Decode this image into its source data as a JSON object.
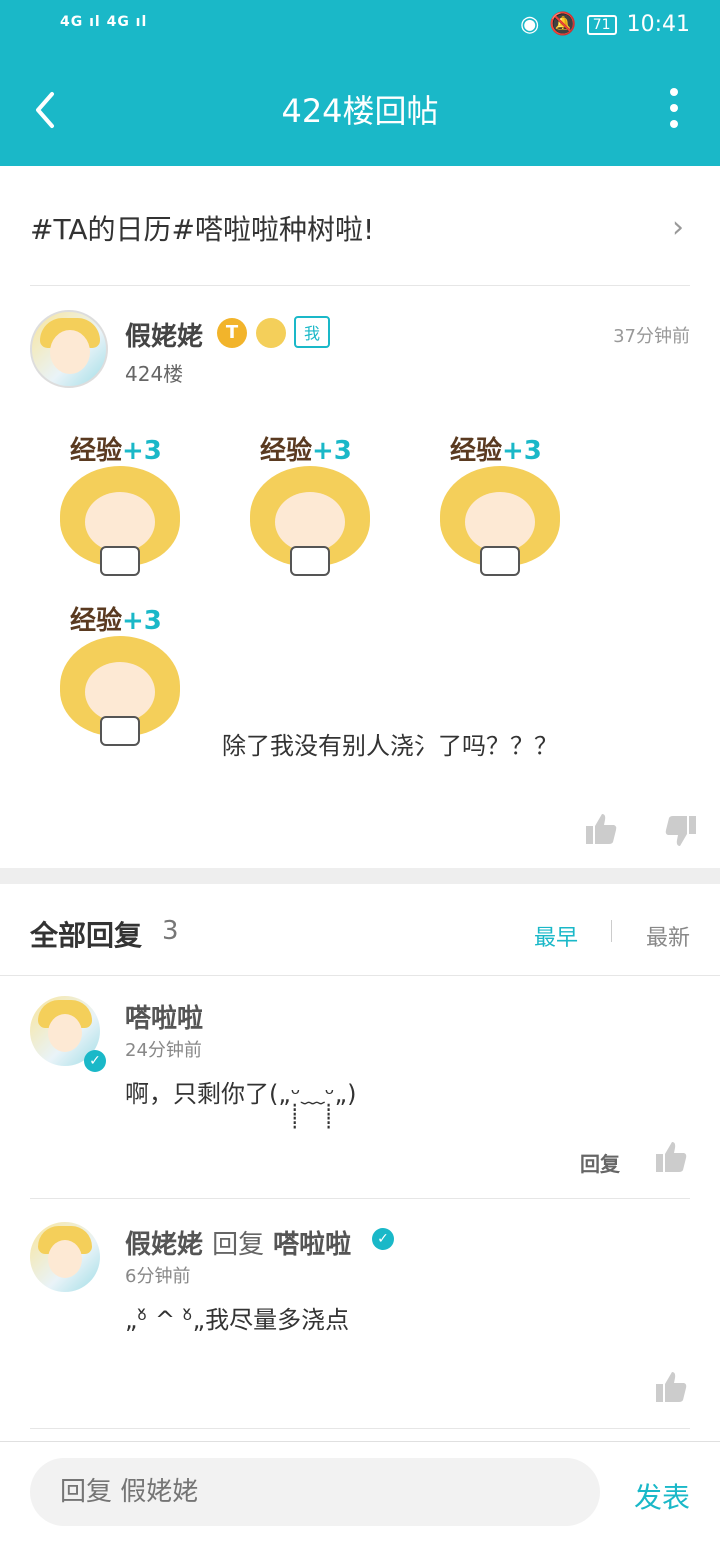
{
  "status_bar": {
    "network": "4G ıl 4G ıl",
    "battery": "71",
    "time": "10:41"
  },
  "header": {
    "title": "424楼回帖"
  },
  "topic": {
    "text": "#TA的日历#嗒啦啦种树啦!"
  },
  "post": {
    "author": "假姥姥",
    "badge_t": "T",
    "me_badge": "我",
    "floor": "424楼",
    "time": "37分钟前",
    "sticker_label_prefix": "经验",
    "sticker_label_bonus": "+3",
    "text": "除了我没有别人浇氵了吗？？？"
  },
  "replies": {
    "title": "全部回复",
    "count": "3",
    "sort_earliest": "最早",
    "sort_latest": "最新",
    "items": [
      {
        "name": "嗒啦啦",
        "time": "24分钟前",
        "content": "啊，只剩你了(„ᵕ̣̣̣̣̣̣﹏ᵕ̣̣̣̣̣̣„)",
        "reply_label": "回复"
      },
      {
        "name": "假姥姥",
        "reply_word": "回复",
        "target": "嗒啦啦",
        "time": "6分钟前",
        "content": "„ᵒ̌ ^ ᵒ̌„我尽量多浇点"
      }
    ]
  },
  "bottom": {
    "placeholder": "回复 假姥姥",
    "send": "发表"
  },
  "colors": {
    "accent": "#1ab8c8",
    "badge_gold": "#f2b42b"
  }
}
